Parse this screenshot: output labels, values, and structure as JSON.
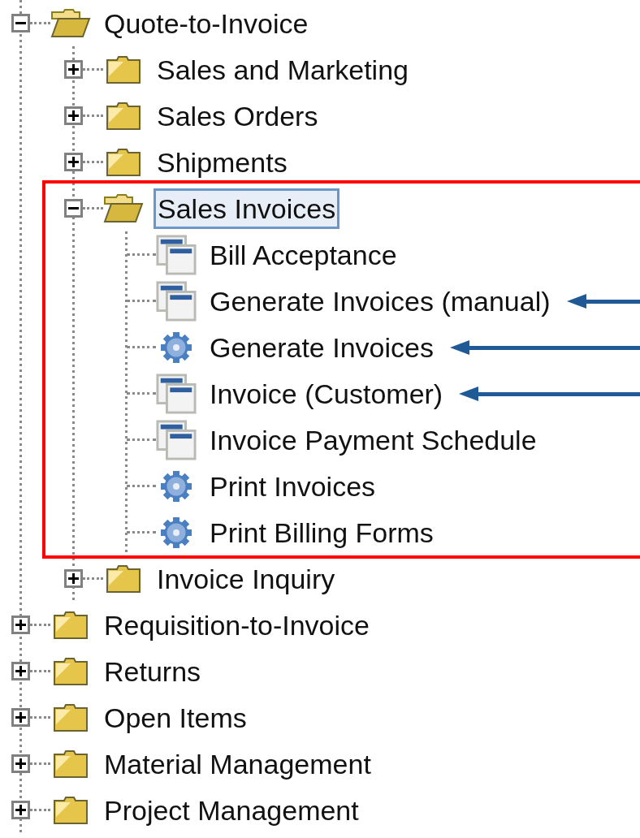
{
  "tree": [
    {
      "label": "Quote-to-Invoice",
      "kind": "folder",
      "expanded": true,
      "selected": false,
      "children": [
        {
          "label": "Sales and Marketing",
          "kind": "folder",
          "expanded": false,
          "selected": false,
          "highlighted": false
        },
        {
          "label": "Sales Orders",
          "kind": "folder",
          "expanded": false,
          "selected": false,
          "highlighted": false
        },
        {
          "label": "Shipments",
          "kind": "folder",
          "expanded": false,
          "selected": false,
          "highlighted": false
        },
        {
          "label": "Sales Invoices",
          "kind": "folder",
          "expanded": true,
          "selected": true,
          "highlighted": true,
          "children": [
            {
              "label": "Bill Acceptance",
              "kind": "window",
              "selected": false,
              "arrow": false
            },
            {
              "label": "Generate Invoices (manual)",
              "kind": "window",
              "selected": false,
              "arrow": true
            },
            {
              "label": "Generate Invoices",
              "kind": "process",
              "selected": false,
              "arrow": true
            },
            {
              "label": "Invoice (Customer)",
              "kind": "window",
              "selected": false,
              "arrow": true
            },
            {
              "label": "Invoice Payment Schedule",
              "kind": "window",
              "selected": false,
              "arrow": false
            },
            {
              "label": "Print Invoices",
              "kind": "process",
              "selected": false,
              "arrow": false
            },
            {
              "label": "Print Billing Forms",
              "kind": "process",
              "selected": false,
              "arrow": false
            }
          ]
        },
        {
          "label": "Invoice Inquiry",
          "kind": "folder",
          "expanded": false,
          "selected": false,
          "highlighted": false
        }
      ]
    },
    {
      "label": "Requisition-to-Invoice",
      "kind": "folder",
      "expanded": false,
      "selected": false
    },
    {
      "label": "Returns",
      "kind": "folder",
      "expanded": false,
      "selected": false
    },
    {
      "label": "Open Items",
      "kind": "folder",
      "expanded": false,
      "selected": false
    },
    {
      "label": "Material Management",
      "kind": "folder",
      "expanded": false,
      "selected": false
    },
    {
      "label": "Project Management",
      "kind": "folder",
      "expanded": false,
      "selected": false
    }
  ]
}
